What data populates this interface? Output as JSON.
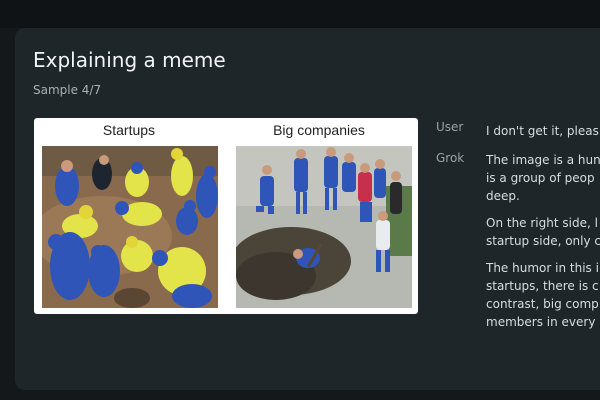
{
  "header": {
    "title": "Explaining a meme",
    "sample": "Sample 4/7"
  },
  "meme": {
    "left_label": "Startups",
    "right_label": "Big companies"
  },
  "chat": {
    "user_role": "User",
    "user_message": "I don't get it, pleas",
    "assistant_role": "Grok",
    "paragraphs": [
      [
        "The image is a hun",
        "is a group of peop",
        "deep."
      ],
      [
        "On the right side, l",
        "startup side, only c"
      ],
      [
        "The humor in this i",
        "startups, there is c",
        "contrast, big comp",
        "members in every"
      ]
    ]
  },
  "colors": {
    "page_bg": "#14181b",
    "card_bg": "#1e262a",
    "worker_blue": "#2f55b8",
    "hi_vis_yellow": "#e3e34a"
  }
}
